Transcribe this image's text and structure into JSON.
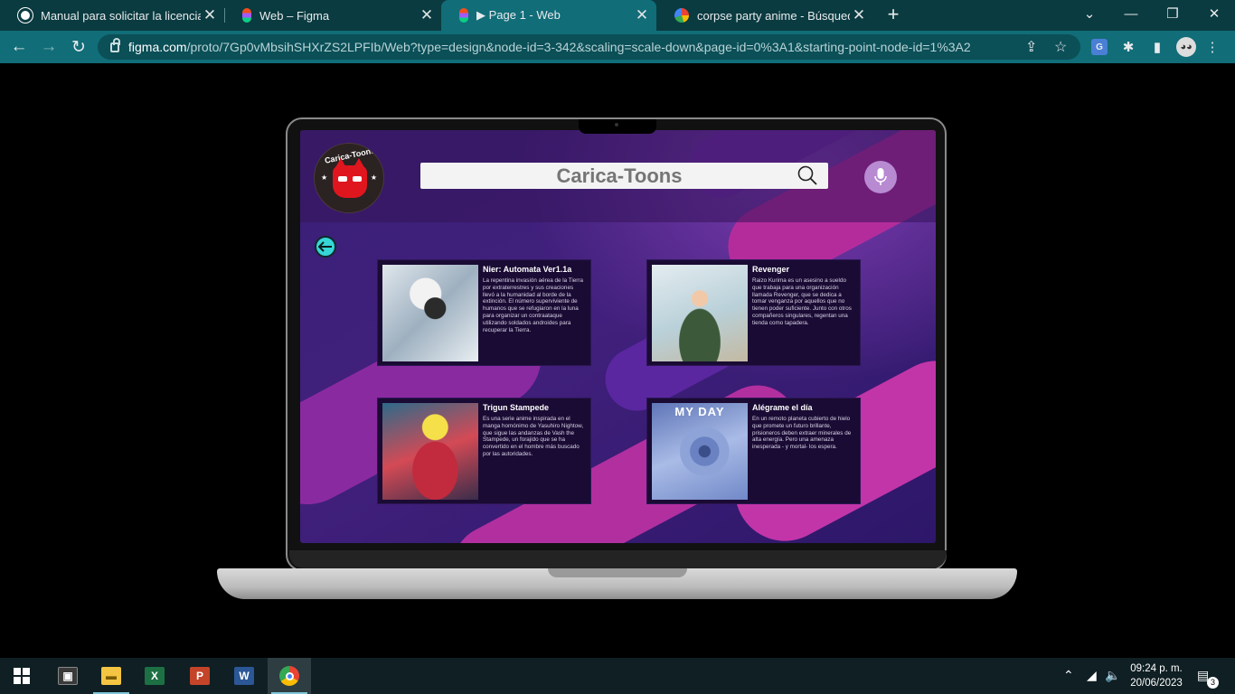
{
  "tabs": [
    {
      "title": "Manual para solicitar la licencia d",
      "favicon": "globe-icon",
      "active": false
    },
    {
      "title": "Web – Figma",
      "favicon": "figma-icon",
      "active": false
    },
    {
      "title": "▶ Page 1 - Web",
      "favicon": "figma-icon",
      "active": true
    },
    {
      "title": "corpse party anime - Búsqueda d",
      "favicon": "google-icon",
      "active": false
    }
  ],
  "address_bar": {
    "host": "figma.com",
    "path": "/proto/7Gp0vMbsihSHXrZS2LPFIb/Web?type=design&node-id=3-342&scaling=scale-down&page-id=0%3A1&starting-point-node-id=1%3A2"
  },
  "app": {
    "logo_text": "Carica-Toons",
    "search_placeholder": "Carica-Toons",
    "cards": [
      {
        "title": "Nier: Automata Ver1.1a",
        "description": "La repentina invasión aérea de la Tierra por extraterrestres y sus creaciones llevó a la humanidad al borde de la extinción. El número superviviente de humanos que se refugiaron en la luna para organizar un contraataque utilizando soldados androides para recuperar la Tierra.",
        "image": "nier-automata-poster"
      },
      {
        "title": "Revenger",
        "description": "Raizo Kurima es un asesino a sueldo que trabaja para una organización llamada Revenger, que se dedica a tomar venganza por aquellos que no tienen poder suficiente. Junto con otros compañeros singulares, regentan una tienda como tapadera.",
        "image": "revenger-poster"
      },
      {
        "title": "Trigun Stampede",
        "description": "Es una serie anime inspirada en el manga homónimo de Yasuhiro Nightow, que sigue las andanzas de Vash the Stampede, un forajido que se ha convertido en el hombre más buscado por las autoridades.",
        "image": "trigun-stampede-poster"
      },
      {
        "title": "Alégrame el día",
        "description": "En un remoto planeta cubierto de hielo que promete un futuro brillante, prisioneros deben extraer minerales de alta energía. Pero una amenaza inesperada - y mortal- los espera.",
        "image": "my-day-poster",
        "image_text": "MY DAY"
      }
    ]
  },
  "taskbar": {
    "apps": [
      "snipping-tool-icon",
      "file-explorer-icon",
      "excel-icon",
      "powerpoint-icon",
      "word-icon",
      "chrome-icon"
    ],
    "time": "09:24 p. m.",
    "date": "20/06/2023",
    "notification_count": "3"
  },
  "colors": {
    "tab_strip": "#0a3b40",
    "toolbar": "#116d78",
    "screen_purple": "#3a1f77",
    "magenta": "#d23aa0",
    "back_button": "#36d6d6",
    "mic_button": "#b88ad2"
  }
}
